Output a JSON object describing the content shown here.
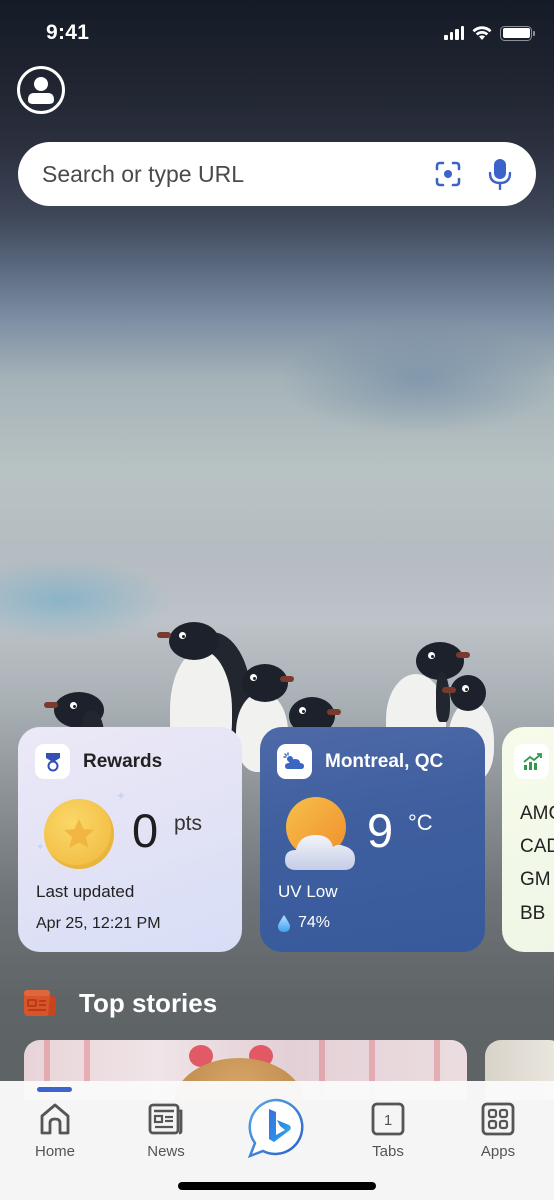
{
  "status_bar": {
    "time": "9:41",
    "signal_icon": "cellular-signal-icon",
    "wifi_icon": "wifi-icon",
    "battery_icon": "battery-icon"
  },
  "header": {
    "profile_icon": "account-circle-icon"
  },
  "search": {
    "placeholder": "Search or type URL",
    "visual_search_icon": "visual-search-icon",
    "mic_icon": "microphone-icon"
  },
  "cards": {
    "rewards": {
      "title": "Rewards",
      "icon": "medal-icon",
      "points": "0",
      "points_unit": "pts",
      "last_updated_label": "Last updated",
      "last_updated_date": "Apr 25, 12:21 PM"
    },
    "weather": {
      "location": "Montreal, QC",
      "icon": "partly-cloudy-icon",
      "temperature": "9",
      "unit": "°C",
      "uv": "UV Low",
      "humidity": "74%"
    },
    "stocks": {
      "icon": "trending-up-icon",
      "tickers": [
        "AMC",
        "CAD",
        "GM",
        "BB"
      ]
    }
  },
  "top_stories": {
    "title": "Top stories",
    "icon": "news-icon"
  },
  "bottom_nav": {
    "items": [
      {
        "label": "Home",
        "icon": "home-icon",
        "active": true
      },
      {
        "label": "News",
        "icon": "newspaper-icon",
        "active": false
      },
      {
        "label": "",
        "icon": "bing-chat-icon",
        "active": false
      },
      {
        "label": "Tabs",
        "icon": "tabs-icon",
        "active": false,
        "count": "1"
      },
      {
        "label": "Apps",
        "icon": "apps-grid-icon",
        "active": false
      }
    ]
  },
  "colors": {
    "accent": "#3e63cc",
    "weather_card": "#3f5f9f",
    "rewards_card": "#e1e2f5",
    "news_icon": "#d9532b"
  }
}
